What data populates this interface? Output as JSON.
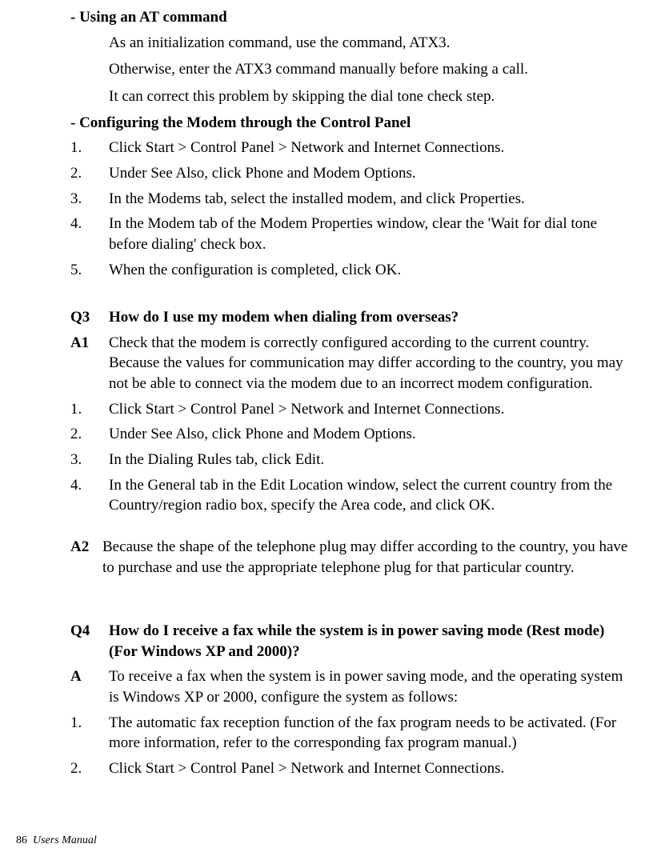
{
  "section_at_heading": "- Using an AT command",
  "section_at_lines": [
    "As an initialization command, use the command, ATX3.",
    "Otherwise, enter the ATX3 command manually before making a call.",
    "It can correct this problem by skipping the dial tone check step."
  ],
  "section_cp_heading": "- Configuring the Modem through the Control Panel",
  "section_cp_steps": [
    "Click Start > Control Panel > Network and Internet Connections.",
    "Under See Also, click Phone and Modem Options.",
    "In the Modems tab, select the installed modem, and click Properties.",
    "In the Modem tab of the Modem Properties window, clear the 'Wait for dial tone before dialing' check box.",
    "When the configuration is completed, click OK."
  ],
  "q3": {
    "label": "Q3",
    "question": "How do I use my modem when dialing from overseas?",
    "a1_label": "A1",
    "a1_text": "Check that the modem is correctly configured according to the current country. Because the values for communication may differ according to the country, you may not be able to connect via the modem due to an incorrect modem configuration.",
    "steps": [
      "Click Start > Control Panel > Network and Internet Connections.",
      "Under See Also, click Phone and Modem Options.",
      "In the Dialing Rules tab, click Edit.",
      "In the General tab in the Edit Location window, select the current country from the Country/region radio box, specify the Area code, and click OK."
    ],
    "a2_label": "A2",
    "a2_text": "Because the shape of the telephone plug may differ according to the country, you have to purchase and use the appropriate telephone plug for that particular country."
  },
  "q4": {
    "label": "Q4",
    "question": "How do I receive a fax while the system is in power saving mode (Rest mode) (For Windows XP and 2000)?",
    "a_label": "A",
    "a_text": "To receive a fax when the system is in power saving mode, and the operating system is Windows XP or 2000, configure the system as follows:",
    "steps": [
      "The automatic fax reception function of the fax program needs to be activated. (For more information, refer to the corresponding fax program manual.)",
      "Click Start > Control Panel > Network and Internet Connections."
    ]
  },
  "ol_numbers": [
    "1.",
    "2.",
    "3.",
    "4.",
    "5."
  ],
  "footer": {
    "page_number": "86",
    "title": "Users Manual"
  }
}
